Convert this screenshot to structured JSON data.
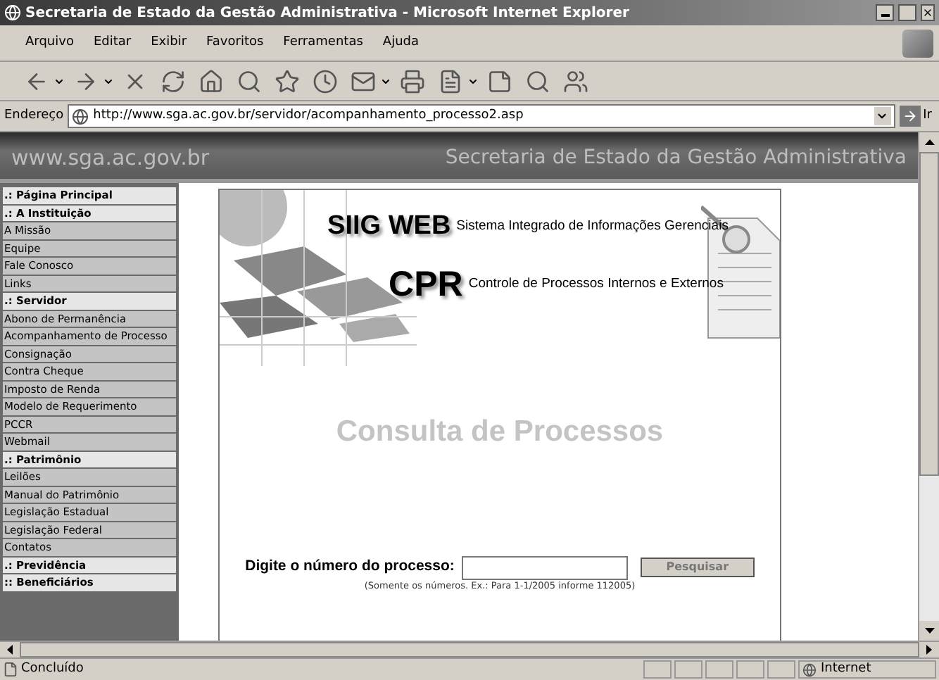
{
  "window": {
    "title": "Secretaria de Estado da Gestão Administrativa - Microsoft Internet Explorer"
  },
  "menu": [
    "Arquivo",
    "Editar",
    "Exibir",
    "Favoritos",
    "Ferramentas",
    "Ajuda"
  ],
  "address_bar": {
    "label": "Endereço",
    "url": "http://www.sga.ac.gov.br/servidor/acompanhamento_processo2.asp",
    "go": "Ir"
  },
  "banner": {
    "site": "www.sga.ac.gov.br",
    "title": "Secretaria de Estado da Gestão Administrativa"
  },
  "sidebar": {
    "items": [
      {
        "label": ".: Página Principal",
        "kind": "header"
      },
      {
        "label": ".: A Instituição",
        "kind": "header"
      },
      {
        "label": "A Missão",
        "kind": "link"
      },
      {
        "label": "Equipe",
        "kind": "link"
      },
      {
        "label": "Fale Conosco",
        "kind": "link"
      },
      {
        "label": "Links",
        "kind": "link"
      },
      {
        "label": ".: Servidor",
        "kind": "header"
      },
      {
        "label": "Abono de Permanência",
        "kind": "link"
      },
      {
        "label": "Acompanhamento de Processo",
        "kind": "link"
      },
      {
        "label": "Consignação",
        "kind": "link"
      },
      {
        "label": "Contra Cheque",
        "kind": "link"
      },
      {
        "label": "Imposto de Renda",
        "kind": "link"
      },
      {
        "label": "Modelo de Requerimento",
        "kind": "link"
      },
      {
        "label": "PCCR",
        "kind": "link"
      },
      {
        "label": "Webmail",
        "kind": "link"
      },
      {
        "label": ".: Patrimônio",
        "kind": "header"
      },
      {
        "label": "Leilões",
        "kind": "link"
      },
      {
        "label": "Manual do Patrimônio",
        "kind": "link"
      },
      {
        "label": "Legislação Estadual",
        "kind": "link"
      },
      {
        "label": "Legislação Federal",
        "kind": "link"
      },
      {
        "label": "Contatos",
        "kind": "link"
      },
      {
        "label": ".: Previdência",
        "kind": "header"
      },
      {
        "label": ":: Beneficiários",
        "kind": "header"
      }
    ]
  },
  "content": {
    "siig_logo": "SIIG WEB",
    "siig_subtitle": "Sistema Integrado de Informações Gerenciais",
    "cpr_logo": "CPR",
    "cpr_subtitle": "Controle de Processos Internos e Externos",
    "heading": "Consulta de Processos",
    "form_label": "Digite o número do processo:",
    "search_button": "Pesquisar",
    "hint": "(Somente os números. Ex.: Para 1-1/2005 informe 112005)"
  },
  "status_bar": {
    "text": "Concluído",
    "zone": "Internet"
  }
}
